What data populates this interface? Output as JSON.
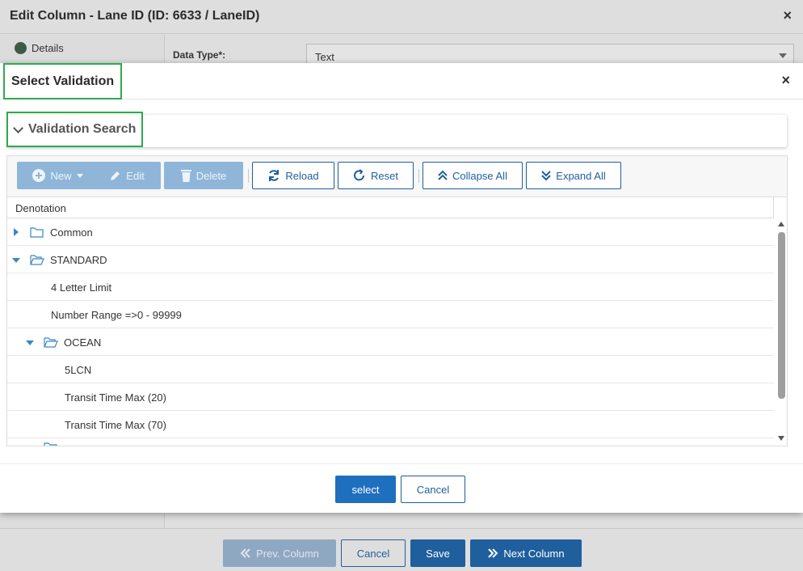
{
  "background_dialog": {
    "title": "Edit Column - Lane ID (ID: 6633 / LaneID)",
    "close_icon": "×",
    "sidebar": {
      "items": [
        {
          "label": "Details",
          "icon": "status-dot-icon"
        }
      ]
    },
    "data_type_label": "Data Type*:",
    "data_type_value": "Text",
    "footer": {
      "prev_label": "Prev. Column",
      "cancel_label": "Cancel",
      "save_label": "Save",
      "next_label": "Next Column"
    }
  },
  "modal": {
    "title": "Select Validation",
    "close_icon": "×",
    "search_panel_title": "Validation Search",
    "toolbar": {
      "new_label": "New",
      "edit_label": "Edit",
      "delete_label": "Delete",
      "reload_label": "Reload",
      "reset_label": "Reset",
      "collapse_all_label": "Collapse All",
      "expand_all_label": "Expand All"
    },
    "grid": {
      "column_header": "Denotation",
      "rows": [
        {
          "label": "Common",
          "type": "folder",
          "expanded": false,
          "level": 0
        },
        {
          "label": "STANDARD",
          "type": "folder",
          "expanded": true,
          "level": 0
        },
        {
          "label": "4 Letter Limit",
          "type": "item",
          "level": 1
        },
        {
          "label": "Number Range =>0 - 99999",
          "type": "item",
          "level": 1
        },
        {
          "label": "OCEAN",
          "type": "folder",
          "expanded": true,
          "level": 1
        },
        {
          "label": "5LCN",
          "type": "item",
          "level": 2
        },
        {
          "label": "Transit Time Max (20)",
          "type": "item",
          "level": 2
        },
        {
          "label": "Transit Time Max (70)",
          "type": "item",
          "level": 2
        }
      ]
    },
    "footer": {
      "select_label": "select",
      "cancel_label": "Cancel"
    }
  },
  "colors": {
    "primary": "#1f5f9d",
    "highlight_border": "#2eaa4f",
    "tree_arrow": "#3b86c6",
    "disabled_button": "#8fb6d9"
  }
}
